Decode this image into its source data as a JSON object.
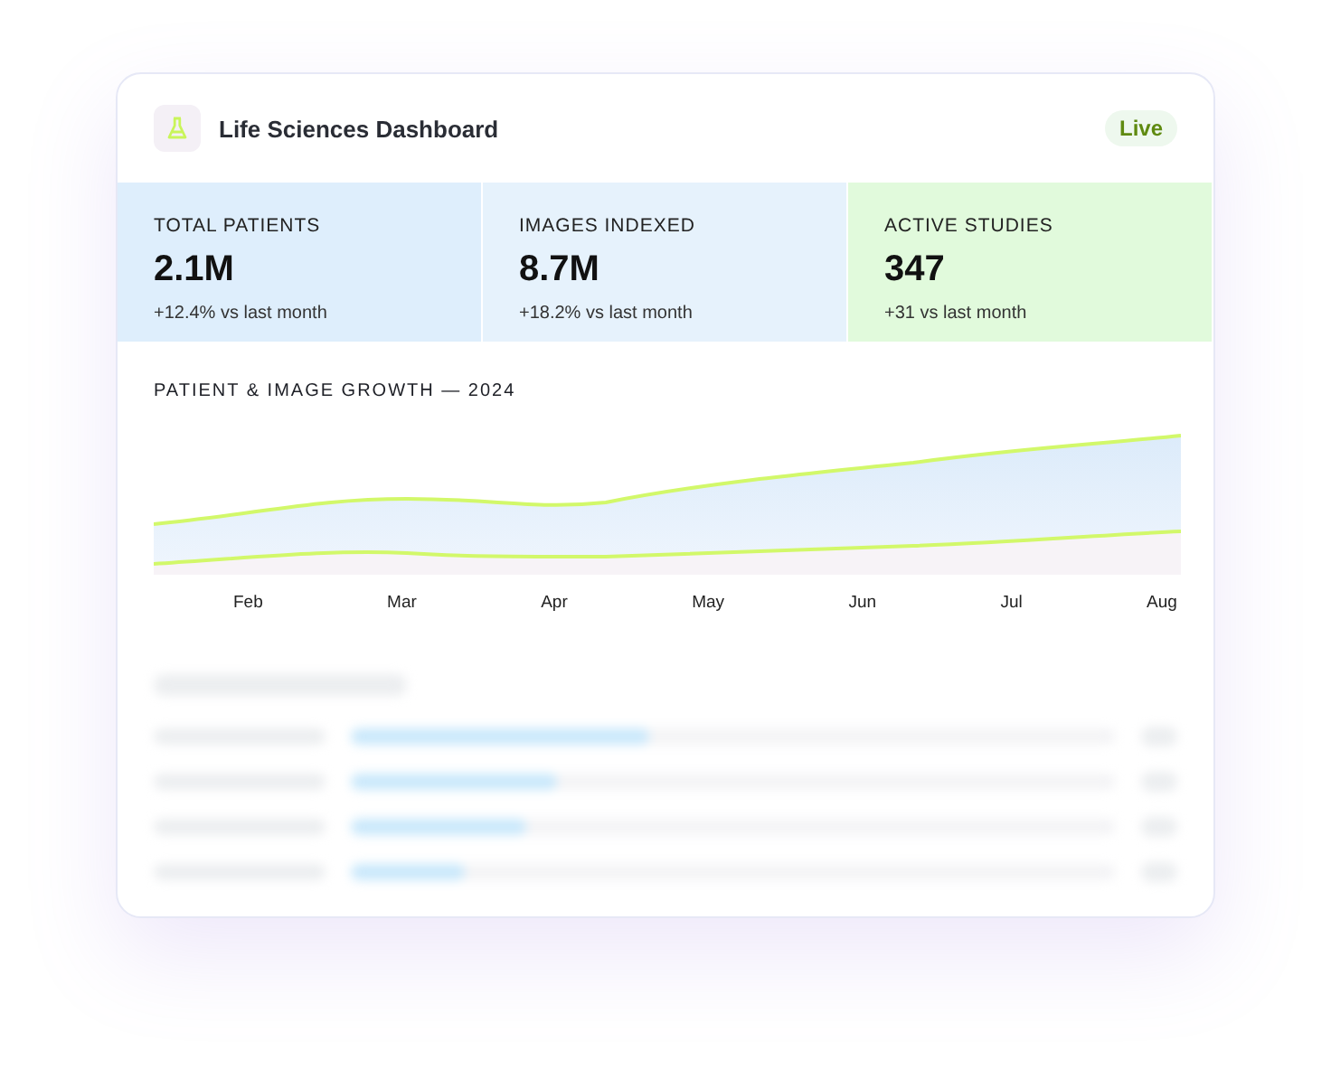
{
  "header": {
    "title": "Life Sciences Dashboard",
    "badge": "Live"
  },
  "stats": [
    {
      "label": "TOTAL PATIENTS",
      "value": "2.1M",
      "change": "+12.4% vs last month",
      "color": "#deeefc"
    },
    {
      "label": "IMAGES INDEXED",
      "value": "8.7M",
      "change": "+18.2% vs last month",
      "color": "#e6f2fc"
    },
    {
      "label": "ACTIVE STUDIES",
      "value": "347",
      "change": "+31 vs last month",
      "color": "#e1fadc"
    }
  ],
  "chart": {
    "title": "PATIENT & IMAGE GROWTH — 2024",
    "x_labels": [
      "Feb",
      "Mar",
      "Apr",
      "May",
      "Jun",
      "Jul",
      "Aug"
    ]
  },
  "blurred_rows": [
    {
      "level": 0.39
    },
    {
      "level": 0.27
    },
    {
      "level": 0.23
    },
    {
      "level": 0.15
    }
  ]
}
